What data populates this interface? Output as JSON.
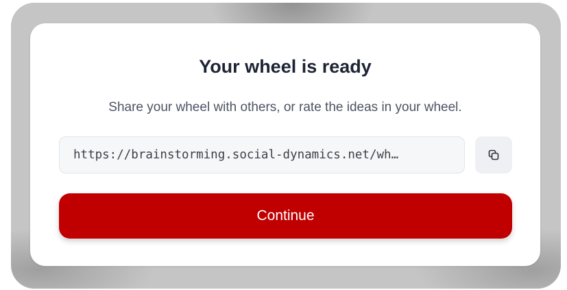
{
  "dialog": {
    "title": "Your wheel is ready",
    "subtitle": "Share your wheel with others, or rate the ideas in your wheel.",
    "share_link": {
      "value": "https://brainstorming.social-dynamics.net/wh…",
      "copy_icon": "copy-icon"
    },
    "continue_label": "Continue"
  },
  "colors": {
    "primary_button": "#c00000",
    "title_text": "#1c2333",
    "subtitle_text": "#4b5363",
    "backdrop": "#c5c5c5"
  }
}
